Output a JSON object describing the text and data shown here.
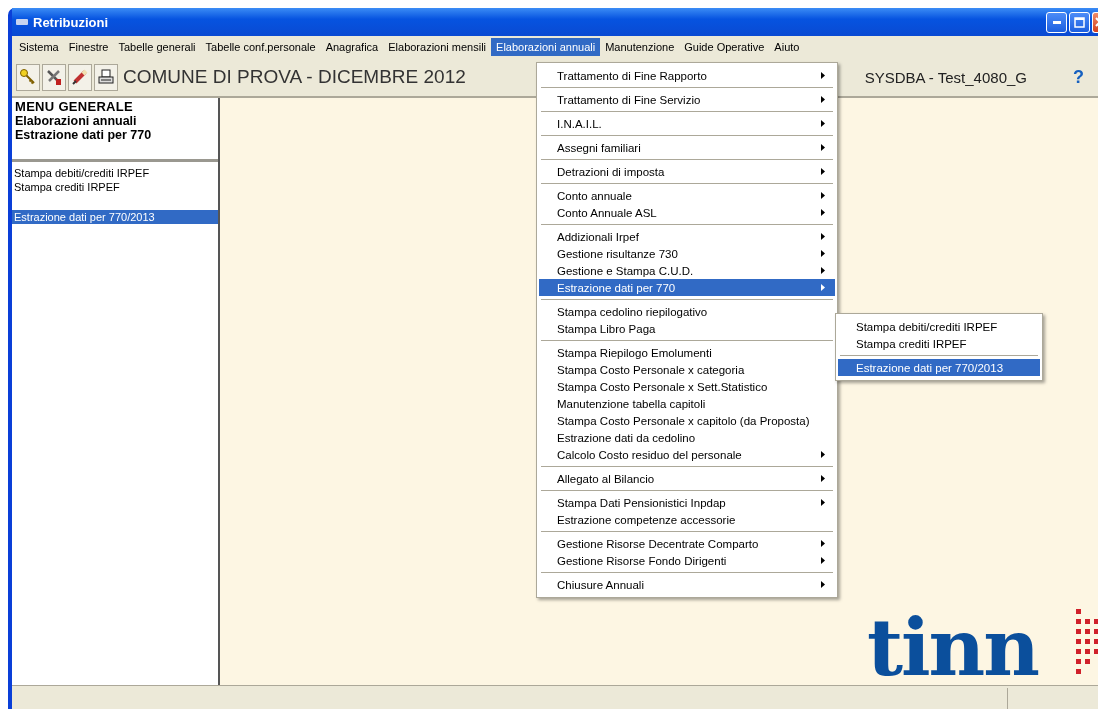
{
  "window": {
    "title": "Retribuzioni"
  },
  "menubar": [
    {
      "label": "Sistema",
      "selected": false
    },
    {
      "label": "Finestre",
      "selected": false
    },
    {
      "label": "Tabelle generali",
      "selected": false
    },
    {
      "label": "Tabelle conf.personale",
      "selected": false
    },
    {
      "label": "Anagrafica",
      "selected": false
    },
    {
      "label": "Elaborazioni mensili",
      "selected": false
    },
    {
      "label": "Elaborazioni annuali",
      "selected": true
    },
    {
      "label": "Manutenzione",
      "selected": false
    },
    {
      "label": "Guide Operative",
      "selected": false
    },
    {
      "label": "Aiuto",
      "selected": false
    }
  ],
  "toolbar": {
    "caption": "COMUNE DI PROVA - DICEMBRE 2012",
    "user": "SYSDBA - Test_4080_G",
    "help": "?"
  },
  "left_panel": {
    "heading": [
      "MENU GENERALE",
      "Elaborazioni annuali",
      "Estrazione dati per 770"
    ],
    "groups": [
      [
        {
          "label": "Stampa debiti/crediti IRPEF",
          "selected": false
        },
        {
          "label": "Stampa crediti IRPEF",
          "selected": false
        }
      ],
      [
        {
          "label": "Estrazione dati per  770/2013",
          "selected": true
        }
      ]
    ]
  },
  "dropdown": {
    "groups": [
      [
        {
          "label": "Trattamento di Fine Rapporto",
          "submenu": true,
          "selected": false
        }
      ],
      [
        {
          "label": "Trattamento di Fine Servizio",
          "submenu": true,
          "selected": false
        }
      ],
      [
        {
          "label": "I.N.A.I.L.",
          "submenu": true,
          "selected": false
        }
      ],
      [
        {
          "label": "Assegni familiari",
          "submenu": true,
          "selected": false
        }
      ],
      [
        {
          "label": "Detrazioni di imposta",
          "submenu": true,
          "selected": false
        }
      ],
      [
        {
          "label": "Conto annuale",
          "submenu": true,
          "selected": false
        },
        {
          "label": "Conto Annuale ASL",
          "submenu": true,
          "selected": false
        }
      ],
      [
        {
          "label": "Addizionali Irpef",
          "submenu": true,
          "selected": false
        },
        {
          "label": "Gestione risultanze 730",
          "submenu": true,
          "selected": false
        },
        {
          "label": "Gestione e Stampa C.U.D.",
          "submenu": true,
          "selected": false
        },
        {
          "label": "Estrazione dati per 770",
          "submenu": true,
          "selected": true
        }
      ],
      [
        {
          "label": "Stampa cedolino riepilogativo",
          "submenu": false,
          "selected": false
        },
        {
          "label": "Stampa Libro Paga",
          "submenu": false,
          "selected": false
        }
      ],
      [
        {
          "label": "Stampa Riepilogo Emolumenti",
          "submenu": false,
          "selected": false
        },
        {
          "label": "Stampa Costo Personale x categoria",
          "submenu": false,
          "selected": false
        },
        {
          "label": "Stampa Costo Personale x Sett.Statistico",
          "submenu": false,
          "selected": false
        },
        {
          "label": "Manutenzione tabella capitoli",
          "submenu": false,
          "selected": false
        },
        {
          "label": "Stampa Costo Personale x capitolo (da Proposta)",
          "submenu": false,
          "selected": false
        },
        {
          "label": "Estrazione dati da cedolino",
          "submenu": false,
          "selected": false
        },
        {
          "label": "Calcolo Costo residuo del personale",
          "submenu": true,
          "selected": false
        }
      ],
      [
        {
          "label": "Allegato al Bilancio",
          "submenu": true,
          "selected": false
        }
      ],
      [
        {
          "label": "Stampa Dati Pensionistici Inpdap",
          "submenu": true,
          "selected": false
        },
        {
          "label": "Estrazione competenze accessorie",
          "submenu": false,
          "selected": false
        }
      ],
      [
        {
          "label": "Gestione Risorse Decentrate Comparto",
          "submenu": true,
          "selected": false
        },
        {
          "label": "Gestione Risorse Fondo Dirigenti",
          "submenu": true,
          "selected": false
        }
      ],
      [
        {
          "label": "Chiusure Annuali",
          "submenu": true,
          "selected": false
        }
      ]
    ]
  },
  "submenu": {
    "groups": [
      [
        {
          "label": "Stampa debiti/crediti IRPEF",
          "selected": false
        },
        {
          "label": "Stampa crediti IRPEF",
          "selected": false
        }
      ],
      [
        {
          "label": "Estrazione dati per  770/2013",
          "selected": true
        }
      ]
    ]
  },
  "logo": {
    "text": "tinn"
  }
}
